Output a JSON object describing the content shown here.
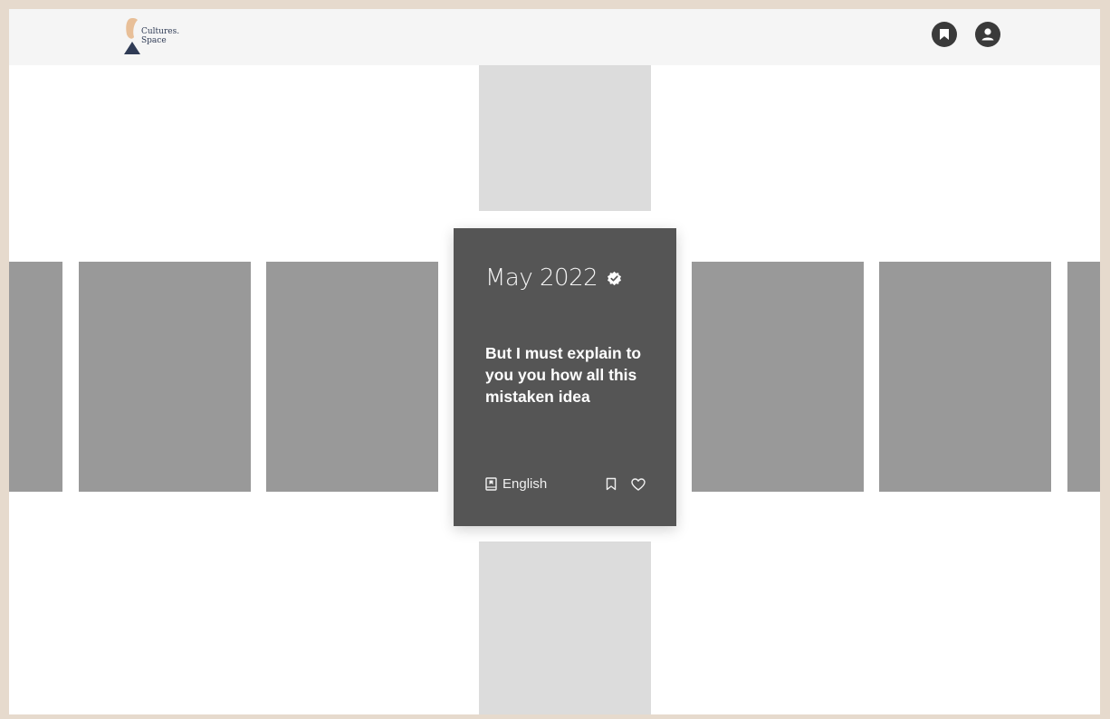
{
  "header": {
    "brand": "Cultures.\nSpace",
    "icons": [
      "bookmark-icon",
      "user-account-icon"
    ]
  },
  "card": {
    "date": "May 2022",
    "verified_icon": "verified-badge-icon",
    "quote": "But I must explain to you you how all this mistaken idea",
    "language": "English",
    "language_icon": "book-icon",
    "actions": [
      "bookmark-icon",
      "heart-icon"
    ]
  },
  "colors": {
    "frame_border": "#e6dacd",
    "topbar": "#f5f5f5",
    "tile": "#999999",
    "tile_light": "#dcdcdc",
    "card": "#555555",
    "logo_navy": "#2f3b55",
    "logo_peach": "#e8bf98"
  }
}
